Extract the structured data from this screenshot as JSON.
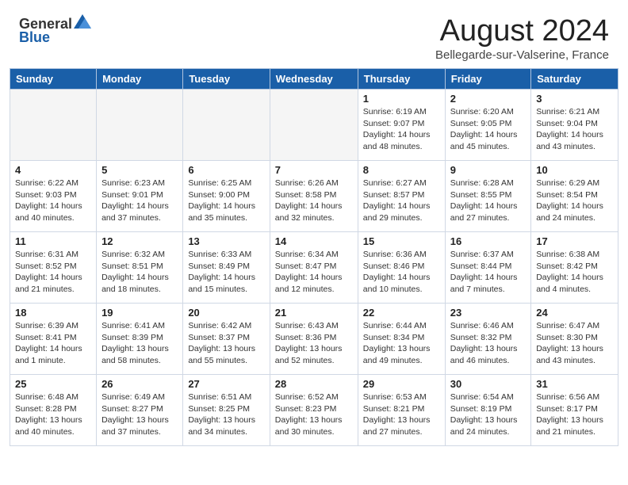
{
  "header": {
    "logo_general": "General",
    "logo_blue": "Blue",
    "month_title": "August 2024",
    "location": "Bellegarde-sur-Valserine, France"
  },
  "calendar": {
    "days_of_week": [
      "Sunday",
      "Monday",
      "Tuesday",
      "Wednesday",
      "Thursday",
      "Friday",
      "Saturday"
    ],
    "weeks": [
      [
        {
          "day": "",
          "info": ""
        },
        {
          "day": "",
          "info": ""
        },
        {
          "day": "",
          "info": ""
        },
        {
          "day": "",
          "info": ""
        },
        {
          "day": "1",
          "info": "Sunrise: 6:19 AM\nSunset: 9:07 PM\nDaylight: 14 hours\nand 48 minutes."
        },
        {
          "day": "2",
          "info": "Sunrise: 6:20 AM\nSunset: 9:05 PM\nDaylight: 14 hours\nand 45 minutes."
        },
        {
          "day": "3",
          "info": "Sunrise: 6:21 AM\nSunset: 9:04 PM\nDaylight: 14 hours\nand 43 minutes."
        }
      ],
      [
        {
          "day": "4",
          "info": "Sunrise: 6:22 AM\nSunset: 9:03 PM\nDaylight: 14 hours\nand 40 minutes."
        },
        {
          "day": "5",
          "info": "Sunrise: 6:23 AM\nSunset: 9:01 PM\nDaylight: 14 hours\nand 37 minutes."
        },
        {
          "day": "6",
          "info": "Sunrise: 6:25 AM\nSunset: 9:00 PM\nDaylight: 14 hours\nand 35 minutes."
        },
        {
          "day": "7",
          "info": "Sunrise: 6:26 AM\nSunset: 8:58 PM\nDaylight: 14 hours\nand 32 minutes."
        },
        {
          "day": "8",
          "info": "Sunrise: 6:27 AM\nSunset: 8:57 PM\nDaylight: 14 hours\nand 29 minutes."
        },
        {
          "day": "9",
          "info": "Sunrise: 6:28 AM\nSunset: 8:55 PM\nDaylight: 14 hours\nand 27 minutes."
        },
        {
          "day": "10",
          "info": "Sunrise: 6:29 AM\nSunset: 8:54 PM\nDaylight: 14 hours\nand 24 minutes."
        }
      ],
      [
        {
          "day": "11",
          "info": "Sunrise: 6:31 AM\nSunset: 8:52 PM\nDaylight: 14 hours\nand 21 minutes."
        },
        {
          "day": "12",
          "info": "Sunrise: 6:32 AM\nSunset: 8:51 PM\nDaylight: 14 hours\nand 18 minutes."
        },
        {
          "day": "13",
          "info": "Sunrise: 6:33 AM\nSunset: 8:49 PM\nDaylight: 14 hours\nand 15 minutes."
        },
        {
          "day": "14",
          "info": "Sunrise: 6:34 AM\nSunset: 8:47 PM\nDaylight: 14 hours\nand 12 minutes."
        },
        {
          "day": "15",
          "info": "Sunrise: 6:36 AM\nSunset: 8:46 PM\nDaylight: 14 hours\nand 10 minutes."
        },
        {
          "day": "16",
          "info": "Sunrise: 6:37 AM\nSunset: 8:44 PM\nDaylight: 14 hours\nand 7 minutes."
        },
        {
          "day": "17",
          "info": "Sunrise: 6:38 AM\nSunset: 8:42 PM\nDaylight: 14 hours\nand 4 minutes."
        }
      ],
      [
        {
          "day": "18",
          "info": "Sunrise: 6:39 AM\nSunset: 8:41 PM\nDaylight: 14 hours\nand 1 minute."
        },
        {
          "day": "19",
          "info": "Sunrise: 6:41 AM\nSunset: 8:39 PM\nDaylight: 13 hours\nand 58 minutes."
        },
        {
          "day": "20",
          "info": "Sunrise: 6:42 AM\nSunset: 8:37 PM\nDaylight: 13 hours\nand 55 minutes."
        },
        {
          "day": "21",
          "info": "Sunrise: 6:43 AM\nSunset: 8:36 PM\nDaylight: 13 hours\nand 52 minutes."
        },
        {
          "day": "22",
          "info": "Sunrise: 6:44 AM\nSunset: 8:34 PM\nDaylight: 13 hours\nand 49 minutes."
        },
        {
          "day": "23",
          "info": "Sunrise: 6:46 AM\nSunset: 8:32 PM\nDaylight: 13 hours\nand 46 minutes."
        },
        {
          "day": "24",
          "info": "Sunrise: 6:47 AM\nSunset: 8:30 PM\nDaylight: 13 hours\nand 43 minutes."
        }
      ],
      [
        {
          "day": "25",
          "info": "Sunrise: 6:48 AM\nSunset: 8:28 PM\nDaylight: 13 hours\nand 40 minutes."
        },
        {
          "day": "26",
          "info": "Sunrise: 6:49 AM\nSunset: 8:27 PM\nDaylight: 13 hours\nand 37 minutes."
        },
        {
          "day": "27",
          "info": "Sunrise: 6:51 AM\nSunset: 8:25 PM\nDaylight: 13 hours\nand 34 minutes."
        },
        {
          "day": "28",
          "info": "Sunrise: 6:52 AM\nSunset: 8:23 PM\nDaylight: 13 hours\nand 30 minutes."
        },
        {
          "day": "29",
          "info": "Sunrise: 6:53 AM\nSunset: 8:21 PM\nDaylight: 13 hours\nand 27 minutes."
        },
        {
          "day": "30",
          "info": "Sunrise: 6:54 AM\nSunset: 8:19 PM\nDaylight: 13 hours\nand 24 minutes."
        },
        {
          "day": "31",
          "info": "Sunrise: 6:56 AM\nSunset: 8:17 PM\nDaylight: 13 hours\nand 21 minutes."
        }
      ]
    ]
  }
}
